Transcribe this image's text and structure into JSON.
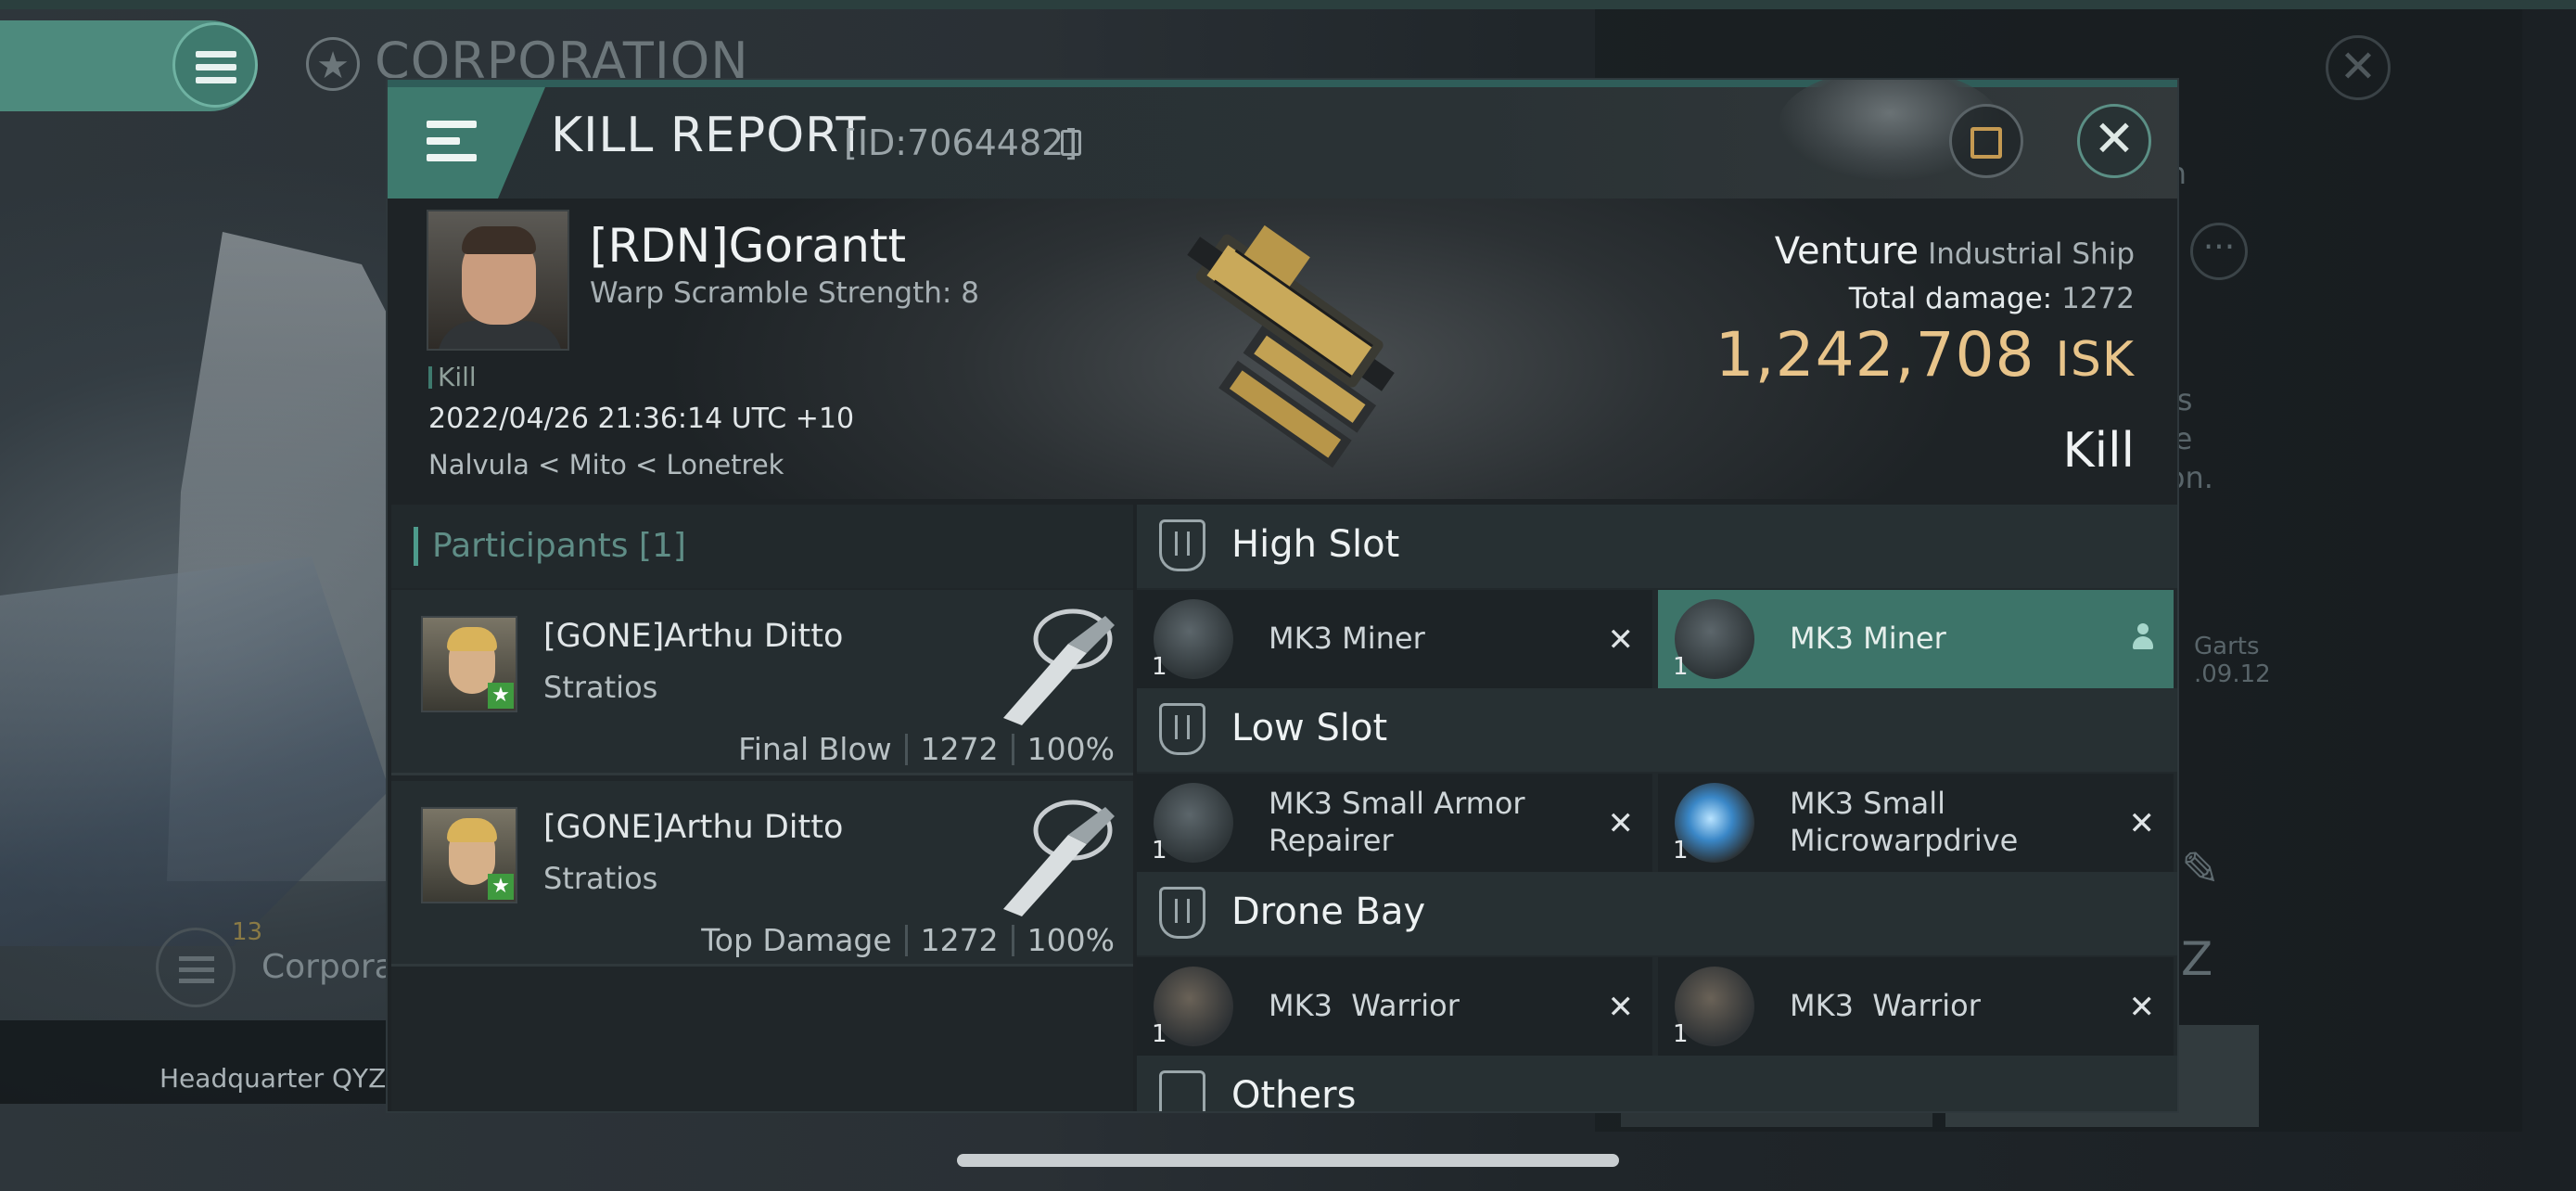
{
  "background": {
    "corp_title": "CORPORATION",
    "corp_label": "Corporation",
    "corp_count": "13",
    "headquarter": "Headquarter QYZ",
    "right_text_1": "en",
    "right_text_2": "es",
    "right_text_3": "se",
    "right_text_4": "ion.",
    "right_text_5": "Garts",
    "right_text_6": ".09.12",
    "dots": "···",
    "close_glyph": "✕",
    "edit_glyph": "✎",
    "z_glyph": "Z"
  },
  "header": {
    "title": "KILL REPORT",
    "id": "[ID:7064482]",
    "close_glyph": "✕",
    "share_glyph": "↗",
    "accent_color": "#3e7a6e"
  },
  "victim": {
    "name": "[RDN]Gorantt",
    "warp_scramble": "Warp Scramble Strength: 8",
    "kill_tag": "Kill",
    "datetime": "2022/04/26 21:36:14 UTC +10",
    "location": "Nalvula < Mito < Lonetrek",
    "ship_name": "Venture",
    "ship_class": "Industrial Ship",
    "total_damage_label": "Total damage:",
    "total_damage": "1272",
    "isk_value": "1,242,708",
    "isk_unit": "ISK",
    "result": "Kill",
    "isk_color": "#e8c48a"
  },
  "participants": {
    "title": "Participants [1]",
    "rows": [
      {
        "name": "[GONE]Arthu Ditto",
        "ship": "Stratios",
        "role": "Final Blow",
        "damage": "1272",
        "percent": "100%",
        "badge": "★"
      },
      {
        "name": "[GONE]Arthu Ditto",
        "ship": "Stratios",
        "role": "Top Damage",
        "damage": "1272",
        "percent": "100%",
        "badge": "★"
      }
    ]
  },
  "fitting": {
    "high_slot": {
      "label": "High Slot",
      "items": [
        {
          "name": "MK3 Miner",
          "qty": "1",
          "action": "✕"
        },
        {
          "name": "MK3 Miner",
          "qty": "1",
          "action": "person"
        }
      ]
    },
    "low_slot": {
      "label": "Low Slot",
      "items": [
        {
          "name_line1": "MK3 Small Armor",
          "name_line2": "Repairer",
          "qty": "1",
          "action": "✕"
        },
        {
          "name_line1": "MK3 Small",
          "name_line2": "Microwarpdrive",
          "qty": "1",
          "action": "✕"
        }
      ]
    },
    "drone_bay": {
      "label": "Drone Bay",
      "items": [
        {
          "name": "MK3  Warrior",
          "qty": "1",
          "action": "✕"
        },
        {
          "name": "MK3  Warrior",
          "qty": "1",
          "action": "✕"
        }
      ]
    },
    "others": {
      "label": "Others"
    }
  }
}
